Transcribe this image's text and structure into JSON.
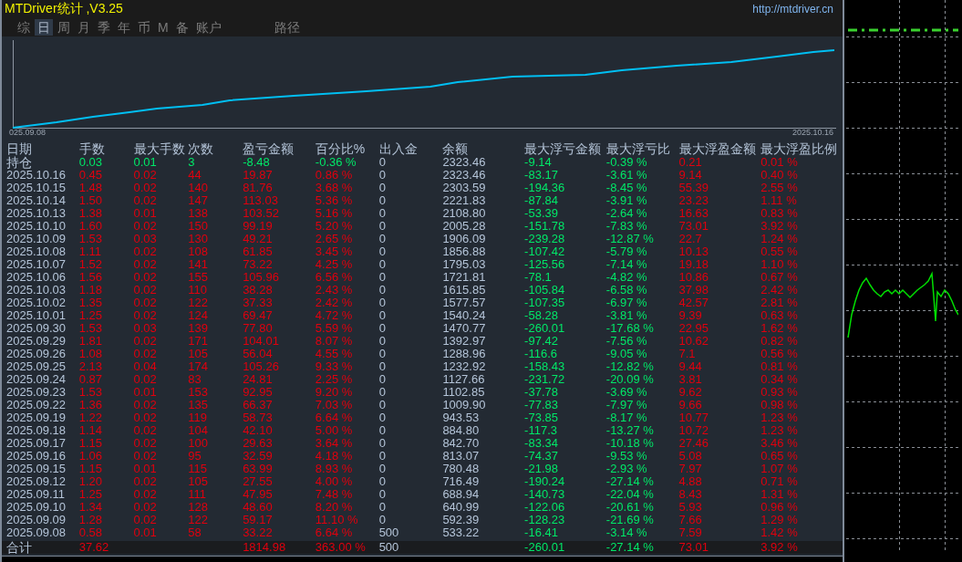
{
  "window": {
    "title": "MTDriver统计 ,V3.25",
    "url": "http://mtdriver.cn"
  },
  "tabs": [
    {
      "label": "综",
      "selected": false
    },
    {
      "label": "日",
      "selected": true
    },
    {
      "label": "周",
      "selected": false
    },
    {
      "label": "月",
      "selected": false
    },
    {
      "label": "季",
      "selected": false
    },
    {
      "label": "年",
      "selected": false
    },
    {
      "label": "币",
      "selected": false
    },
    {
      "label": "M",
      "selected": false
    },
    {
      "label": "备",
      "selected": false
    },
    {
      "label": "账户",
      "selected": false
    },
    {
      "label": "路径",
      "selected": false
    }
  ],
  "equity_chart": {
    "start_label": "025.09.08",
    "end_label": "2025.10.16"
  },
  "table": {
    "columns": [
      "日期",
      "手数",
      "最大手数",
      "次数",
      "盈亏金额",
      "百分比%",
      "出入金",
      "余额",
      "最大浮亏金额",
      "最大浮亏比",
      "最大浮盈金额",
      "最大浮盈比例"
    ],
    "rows": [
      {
        "kind": "holding",
        "cells": [
          "持仓",
          "0.03",
          "0.01",
          "3",
          "-8.48",
          "-0.36 %",
          "0",
          "2323.46",
          "-9.14",
          "-0.39 %",
          "0.21",
          "0.01 %"
        ]
      },
      {
        "kind": "day",
        "cells": [
          "2025.10.16",
          "0.45",
          "0.02",
          "44",
          "19.87",
          "0.86 %",
          "0",
          "2323.46",
          "-83.17",
          "-3.61 %",
          "9.14",
          "0.40 %"
        ]
      },
      {
        "kind": "day",
        "cells": [
          "2025.10.15",
          "1.48",
          "0.02",
          "140",
          "81.76",
          "3.68 %",
          "0",
          "2303.59",
          "-194.36",
          "-8.45 %",
          "55.39",
          "2.55 %"
        ]
      },
      {
        "kind": "day",
        "cells": [
          "2025.10.14",
          "1.50",
          "0.02",
          "147",
          "113.03",
          "5.36 %",
          "0",
          "2221.83",
          "-87.84",
          "-3.91 %",
          "23.23",
          "1.11 %"
        ]
      },
      {
        "kind": "day",
        "cells": [
          "2025.10.13",
          "1.38",
          "0.01",
          "138",
          "103.52",
          "5.16 %",
          "0",
          "2108.80",
          "-53.39",
          "-2.64 %",
          "16.63",
          "0.83 %"
        ]
      },
      {
        "kind": "day",
        "cells": [
          "2025.10.10",
          "1.60",
          "0.02",
          "150",
          "99.19",
          "5.20 %",
          "0",
          "2005.28",
          "-151.78",
          "-7.83 %",
          "73.01",
          "3.92 %"
        ]
      },
      {
        "kind": "day",
        "cells": [
          "2025.10.09",
          "1.53",
          "0.03",
          "130",
          "49.21",
          "2.65 %",
          "0",
          "1906.09",
          "-239.28",
          "-12.87 %",
          "22.7",
          "1.24 %"
        ]
      },
      {
        "kind": "day",
        "cells": [
          "2025.10.08",
          "1.11",
          "0.02",
          "108",
          "61.85",
          "3.45 %",
          "0",
          "1856.88",
          "-107.42",
          "-5.79 %",
          "10.13",
          "0.55 %"
        ]
      },
      {
        "kind": "day",
        "cells": [
          "2025.10.07",
          "1.52",
          "0.02",
          "141",
          "73.22",
          "4.25 %",
          "0",
          "1795.03",
          "-125.56",
          "-7.14 %",
          "19.18",
          "1.10 %"
        ]
      },
      {
        "kind": "day",
        "cells": [
          "2025.10.06",
          "1.56",
          "0.02",
          "155",
          "105.96",
          "6.56 %",
          "0",
          "1721.81",
          "-78.1",
          "-4.82 %",
          "10.86",
          "0.67 %"
        ]
      },
      {
        "kind": "day",
        "cells": [
          "2025.10.03",
          "1.18",
          "0.02",
          "110",
          "38.28",
          "2.43 %",
          "0",
          "1615.85",
          "-105.84",
          "-6.58 %",
          "37.98",
          "2.42 %"
        ]
      },
      {
        "kind": "day",
        "cells": [
          "2025.10.02",
          "1.35",
          "0.02",
          "122",
          "37.33",
          "2.42 %",
          "0",
          "1577.57",
          "-107.35",
          "-6.97 %",
          "42.57",
          "2.81 %"
        ]
      },
      {
        "kind": "day",
        "cells": [
          "2025.10.01",
          "1.25",
          "0.02",
          "124",
          "69.47",
          "4.72 %",
          "0",
          "1540.24",
          "-58.28",
          "-3.81 %",
          "9.39",
          "0.63 %"
        ]
      },
      {
        "kind": "day",
        "cells": [
          "2025.09.30",
          "1.53",
          "0.03",
          "139",
          "77.80",
          "5.59 %",
          "0",
          "1470.77",
          "-260.01",
          "-17.68 %",
          "22.95",
          "1.62 %"
        ]
      },
      {
        "kind": "day",
        "cells": [
          "2025.09.29",
          "1.81",
          "0.02",
          "171",
          "104.01",
          "8.07 %",
          "0",
          "1392.97",
          "-97.42",
          "-7.56 %",
          "10.62",
          "0.82 %"
        ]
      },
      {
        "kind": "day",
        "cells": [
          "2025.09.26",
          "1.08",
          "0.02",
          "105",
          "56.04",
          "4.55 %",
          "0",
          "1288.96",
          "-116.6",
          "-9.05 %",
          "7.1",
          "0.56 %"
        ]
      },
      {
        "kind": "day",
        "cells": [
          "2025.09.25",
          "2.13",
          "0.04",
          "174",
          "105.26",
          "9.33 %",
          "0",
          "1232.92",
          "-158.43",
          "-12.82 %",
          "9.44",
          "0.81 %"
        ]
      },
      {
        "kind": "day",
        "cells": [
          "2025.09.24",
          "0.87",
          "0.02",
          "83",
          "24.81",
          "2.25 %",
          "0",
          "1127.66",
          "-231.72",
          "-20.09 %",
          "3.81",
          "0.34 %"
        ]
      },
      {
        "kind": "day",
        "cells": [
          "2025.09.23",
          "1.53",
          "0.01",
          "153",
          "92.95",
          "9.20 %",
          "0",
          "1102.85",
          "-37.78",
          "-3.69 %",
          "9.62",
          "0.93 %"
        ]
      },
      {
        "kind": "day",
        "cells": [
          "2025.09.22",
          "1.36",
          "0.02",
          "135",
          "66.37",
          "7.03 %",
          "0",
          "1009.90",
          "-77.83",
          "-7.97 %",
          "9.66",
          "0.98 %"
        ]
      },
      {
        "kind": "day",
        "cells": [
          "2025.09.19",
          "1.22",
          "0.02",
          "119",
          "58.73",
          "6.64 %",
          "0",
          "943.53",
          "-73.85",
          "-8.17 %",
          "10.77",
          "1.23 %"
        ]
      },
      {
        "kind": "day",
        "cells": [
          "2025.09.18",
          "1.14",
          "0.02",
          "104",
          "42.10",
          "5.00 %",
          "0",
          "884.80",
          "-117.3",
          "-13.27 %",
          "10.72",
          "1.23 %"
        ]
      },
      {
        "kind": "day",
        "cells": [
          "2025.09.17",
          "1.15",
          "0.02",
          "100",
          "29.63",
          "3.64 %",
          "0",
          "842.70",
          "-83.34",
          "-10.18 %",
          "27.46",
          "3.46 %"
        ]
      },
      {
        "kind": "day",
        "cells": [
          "2025.09.16",
          "1.06",
          "0.02",
          "95",
          "32.59",
          "4.18 %",
          "0",
          "813.07",
          "-74.37",
          "-9.53 %",
          "5.08",
          "0.65 %"
        ]
      },
      {
        "kind": "day",
        "cells": [
          "2025.09.15",
          "1.15",
          "0.01",
          "115",
          "63.99",
          "8.93 %",
          "0",
          "780.48",
          "-21.98",
          "-2.93 %",
          "7.97",
          "1.07 %"
        ]
      },
      {
        "kind": "day",
        "cells": [
          "2025.09.12",
          "1.20",
          "0.02",
          "105",
          "27.55",
          "4.00 %",
          "0",
          "716.49",
          "-190.24",
          "-27.14 %",
          "4.88",
          "0.71 %"
        ]
      },
      {
        "kind": "day",
        "cells": [
          "2025.09.11",
          "1.25",
          "0.02",
          "111",
          "47.95",
          "7.48 %",
          "0",
          "688.94",
          "-140.73",
          "-22.04 %",
          "8.43",
          "1.31 %"
        ]
      },
      {
        "kind": "day",
        "cells": [
          "2025.09.10",
          "1.34",
          "0.02",
          "128",
          "48.60",
          "8.20 %",
          "0",
          "640.99",
          "-122.06",
          "-20.61 %",
          "5.93",
          "0.96 %"
        ]
      },
      {
        "kind": "day",
        "cells": [
          "2025.09.09",
          "1.28",
          "0.02",
          "122",
          "59.17",
          "11.10 %",
          "0",
          "592.39",
          "-128.23",
          "-21.69 %",
          "7.66",
          "1.29 %"
        ]
      },
      {
        "kind": "day",
        "cells": [
          "2025.09.08",
          "0.58",
          "0.01",
          "58",
          "33.22",
          "6.64 %",
          "500",
          "533.22",
          "-16.41",
          "-3.14 %",
          "7.59",
          "1.42 %"
        ]
      },
      {
        "kind": "total",
        "cells": [
          "合计",
          "37.62",
          null,
          null,
          "1814.98",
          "363.00 %",
          "500",
          null,
          "-260.01",
          "-27.14 %",
          "73.01",
          "3.92 %"
        ]
      }
    ]
  }
}
